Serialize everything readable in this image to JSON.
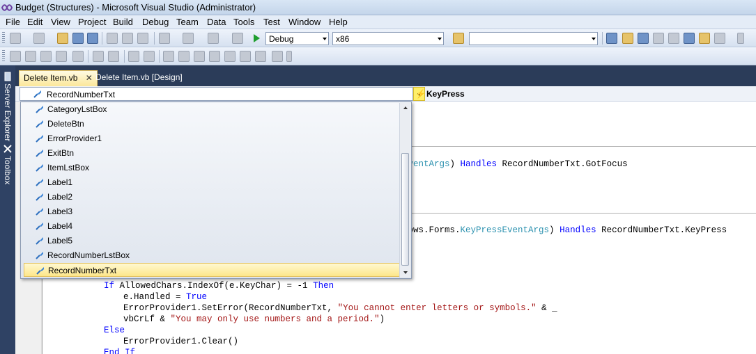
{
  "window": {
    "title": "Budget (Structures) - Microsoft Visual Studio (Administrator)"
  },
  "menu": [
    "File",
    "Edit",
    "View",
    "Project",
    "Build",
    "Debug",
    "Team",
    "Data",
    "Tools",
    "Test",
    "Window",
    "Help"
  ],
  "toolbar": {
    "config_value": "Debug",
    "platform_value": "x86",
    "find_value": ""
  },
  "sidebar": {
    "server_explorer": "Server Explorer",
    "toolbox": "Toolbox"
  },
  "tabs": [
    {
      "label": "Delete Item.vb",
      "close": "✕"
    },
    {
      "label": "Delete Item.vb [Design]"
    }
  ],
  "nav": {
    "object_value": "RecordNumberTxt",
    "event_value": "KeyPress"
  },
  "dropdown": {
    "items": [
      "CategoryLstBox",
      "DeleteBtn",
      "ErrorProvider1",
      "ExitBtn",
      "ItemLstBox",
      "Label1",
      "Label2",
      "Label3",
      "Label4",
      "Label5",
      "RecordNumberLstBox",
      "RecordNumberTxt"
    ],
    "selected": "RecordNumberTxt"
  },
  "code": {
    "l1a": "EventArgs",
    "l1b": ") ",
    "l1c": "Handles",
    "l1d": " RecordNumberTxt.GotFocus",
    "l2a": "dows.Forms.",
    "l2b": "KeyPressEventArgs",
    "l2c": ") ",
    "l2d": "Handles",
    "l2e": " RecordNumberTxt.KeyPress",
    "l3a": "If",
    "l3b": " AllowedChars.IndexOf(e.KeyChar) = -1 ",
    "l3c": "Then",
    "l4a": "e.Handled = ",
    "l4b": "True",
    "l5a": "ErrorProvider1.SetError(RecordNumberTxt, ",
    "l5b": "\"You cannot enter letters or symbols.\"",
    "l5c": " & _",
    "l6a": "vbCrLf & ",
    "l6b": "\"You may only use numbers and a period.\"",
    "l6c": ")",
    "l7": "Else",
    "l8": "ErrorProvider1.Clear()",
    "l9": "End If"
  },
  "colors": {
    "keyword": "#0000ff",
    "type": "#2b91af",
    "string": "#a31515",
    "highlight": "#ffef6a"
  }
}
